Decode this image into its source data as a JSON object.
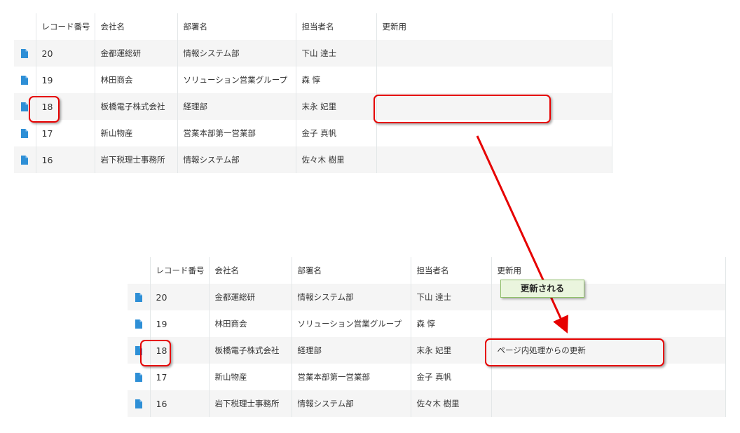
{
  "columns": {
    "record_no": "レコード番号",
    "company": "会社名",
    "department": "部署名",
    "person": "担当者名",
    "update": "更新用"
  },
  "before": {
    "rows": [
      {
        "record_no": "20",
        "company": "金都運総研",
        "department": "情報システム部",
        "person": "下山 達士",
        "update": ""
      },
      {
        "record_no": "19",
        "company": "林田商会",
        "department": "ソリューション営業グループ",
        "person": "森 惇",
        "update": ""
      },
      {
        "record_no": "18",
        "company": "板橋電子株式会社",
        "department": "経理部",
        "person": "末永 妃里",
        "update": ""
      },
      {
        "record_no": "17",
        "company": "新山物産",
        "department": "営業本部第一営業部",
        "person": "金子 真帆",
        "update": ""
      },
      {
        "record_no": "16",
        "company": "岩下税理士事務所",
        "department": "情報システム部",
        "person": "佐々木 樹里",
        "update": ""
      }
    ]
  },
  "after": {
    "rows": [
      {
        "record_no": "20",
        "company": "金都運総研",
        "department": "情報システム部",
        "person": "下山 達士",
        "update": ""
      },
      {
        "record_no": "19",
        "company": "林田商会",
        "department": "ソリューション営業グループ",
        "person": "森 惇",
        "update": ""
      },
      {
        "record_no": "18",
        "company": "板橋電子株式会社",
        "department": "経理部",
        "person": "末永 妃里",
        "update": "ページ内処理からの更新"
      },
      {
        "record_no": "17",
        "company": "新山物産",
        "department": "営業本部第一営業部",
        "person": "金子 真帆",
        "update": ""
      },
      {
        "record_no": "16",
        "company": "岩下税理士事務所",
        "department": "情報システム部",
        "person": "佐々木 樹里",
        "update": ""
      }
    ]
  },
  "callout": {
    "text": "更新される"
  },
  "colors": {
    "highlight": "#e60000",
    "doc_icon": "#2e8fd6",
    "callout_bg": "#eaf5de"
  },
  "icons": {
    "row_icon": "document-icon"
  }
}
